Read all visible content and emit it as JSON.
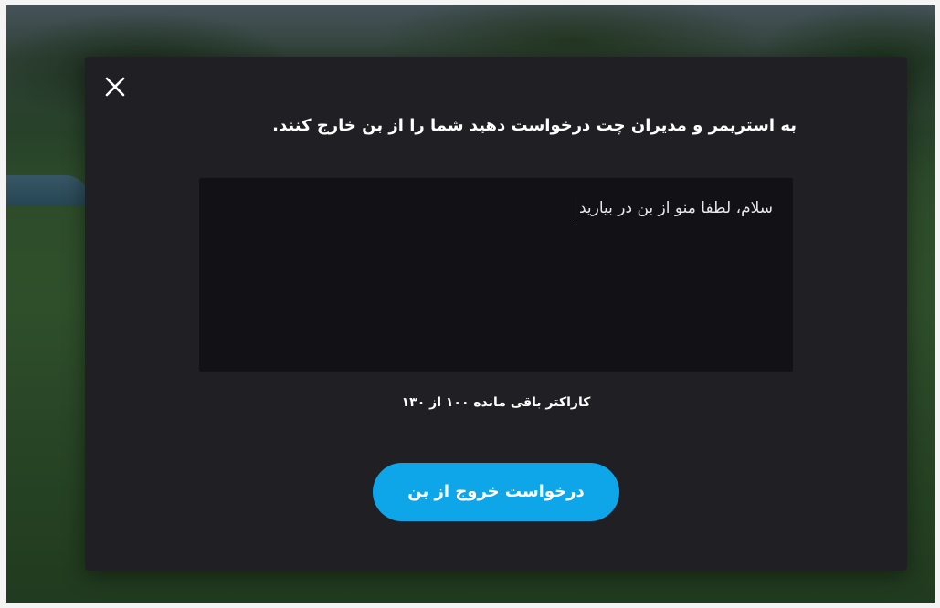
{
  "dialog": {
    "title": "به استریمر و مدیران چت درخواست دهید شما را از بن خارج کنند.",
    "message_value": "سلام، لطفا منو از بن در بیارید",
    "counter_text": "کاراکتر باقی مانده ۱۰۰ از ۱۳۰",
    "submit_label": "درخواست خروج از بن",
    "close_icon": "close-icon"
  },
  "colors": {
    "modal_background": "#202024",
    "input_background": "#121216",
    "accent": "#0ea5e9"
  }
}
